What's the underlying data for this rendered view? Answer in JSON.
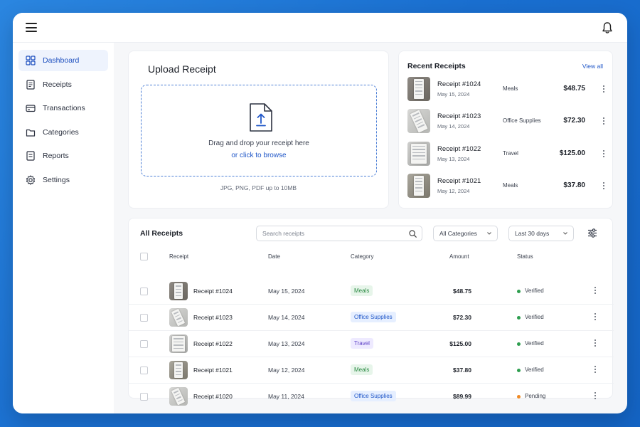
{
  "header": {
    "menu_icon": "hamburger-icon",
    "notification_icon": "bell-icon"
  },
  "sidebar": {
    "items": [
      {
        "label": "Dashboard",
        "icon": "grid-icon",
        "active": true
      },
      {
        "label": "Receipts",
        "icon": "receipt-icon",
        "active": false
      },
      {
        "label": "Transactions",
        "icon": "card-icon",
        "active": false
      },
      {
        "label": "Categories",
        "icon": "folder-icon",
        "active": false
      },
      {
        "label": "Reports",
        "icon": "report-icon",
        "active": false
      },
      {
        "label": "Settings",
        "icon": "gear-icon",
        "active": false
      }
    ]
  },
  "upload": {
    "title": "Upload Receipt",
    "drop_text": "Drag and drop your receipt here",
    "browse_text": "or click to browse",
    "hint": "JPG, PNG, PDF up to 10MB"
  },
  "recent": {
    "title": "Recent Receipts",
    "view_all": "View all",
    "items": [
      {
        "name": "Receipt #1024",
        "date": "May 15, 2024",
        "category": "Meals",
        "amount": "$48.75"
      },
      {
        "name": "Receipt #1023",
        "date": "May 14, 2024",
        "category": "Office Supplies",
        "amount": "$72.30"
      },
      {
        "name": "Receipt #1022",
        "date": "May 13, 2024",
        "category": "Travel",
        "amount": "$125.00"
      },
      {
        "name": "Receipt #1021",
        "date": "May 12, 2024",
        "category": "Meals",
        "amount": "$37.80"
      }
    ]
  },
  "all_receipts": {
    "title": "All Receipts",
    "search_placeholder": "Search receipts",
    "category_filter": "All Categories",
    "date_filter": "Last 30 days",
    "columns": [
      "Receipt",
      "Date",
      "Category",
      "Amount",
      "Status"
    ],
    "rows": [
      {
        "name": "Receipt #1024",
        "date": "May 15, 2024",
        "category": "Meals",
        "amount": "$48.75",
        "status": "Verified"
      },
      {
        "name": "Receipt #1023",
        "date": "May 14, 2024",
        "category": "Office Supplies",
        "amount": "$72.30",
        "status": "Verified"
      },
      {
        "name": "Receipt #1022",
        "date": "May 13, 2024",
        "category": "Travel",
        "amount": "$125.00",
        "status": "Verified"
      },
      {
        "name": "Receipt #1021",
        "date": "May 12, 2024",
        "category": "Meals",
        "amount": "$37.80",
        "status": "Verified"
      },
      {
        "name": "Receipt #1020",
        "date": "May 11, 2024",
        "category": "Office Supplies",
        "amount": "$89.99",
        "status": "Pending"
      }
    ]
  },
  "colors": {
    "accent": "#2057c8",
    "verified": "#2e9e4f",
    "pending": "#f08a24",
    "background": "#1a6fd0"
  }
}
